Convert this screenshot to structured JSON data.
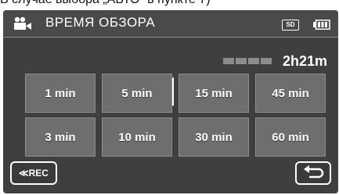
{
  "caption": "В случае выбора „АВТО“ в пункте 7)",
  "header": {
    "title": "ВРЕМЯ ОБЗОРА",
    "media": "SD",
    "icons": [
      "video-camera-icon",
      "sd-card-icon",
      "battery-icon"
    ]
  },
  "remaining_time": "2h21m",
  "interval_buttons": [
    {
      "label": "1 min"
    },
    {
      "label": "5 min"
    },
    {
      "label": "15 min"
    },
    {
      "label": "45 min"
    },
    {
      "label": "3 min"
    },
    {
      "label": "10 min"
    },
    {
      "label": "30 min"
    },
    {
      "label": "60 min"
    }
  ],
  "footer": {
    "rec_label": "≪REC",
    "back_icon": "return-arrow-icon"
  },
  "colors": {
    "screen_bg": "#3f3f3f",
    "button_bg": "#6e6e6e",
    "text": "#ffffff"
  }
}
